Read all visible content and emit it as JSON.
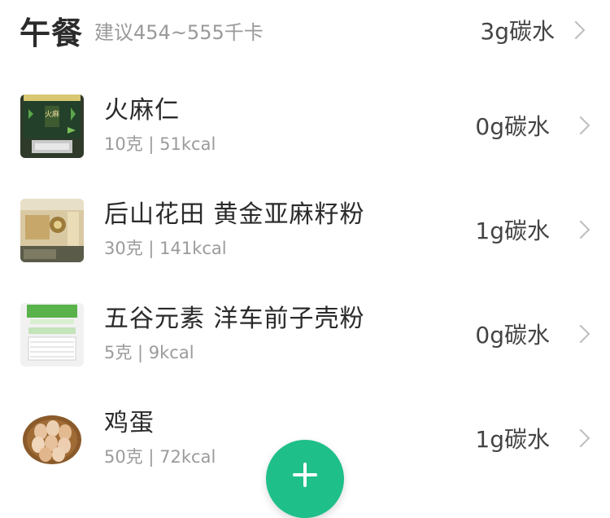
{
  "meal": {
    "title": "午餐",
    "suggest": "建议454~555千卡",
    "carb": "3g碳水"
  },
  "items": [
    {
      "name": "火麻仁",
      "sub": "10克 | 51kcal",
      "carb": "0g碳水",
      "thumb_icon": "hemp-seed-package-image"
    },
    {
      "name": "后山花田 黄金亚麻籽粉",
      "sub": "30克 | 141kcal",
      "carb": "1g碳水",
      "thumb_icon": "flaxseed-powder-package-image"
    },
    {
      "name": "五谷元素 洋车前子壳粉",
      "sub": "5克 | 9kcal",
      "carb": "0g碳水",
      "thumb_icon": "psyllium-husk-package-image"
    },
    {
      "name": "鸡蛋",
      "sub": "50克 | 72kcal",
      "carb": "1g碳水",
      "thumb_icon": "eggs-basket-image"
    }
  ],
  "colors": {
    "accent": "#1fbf8a"
  }
}
